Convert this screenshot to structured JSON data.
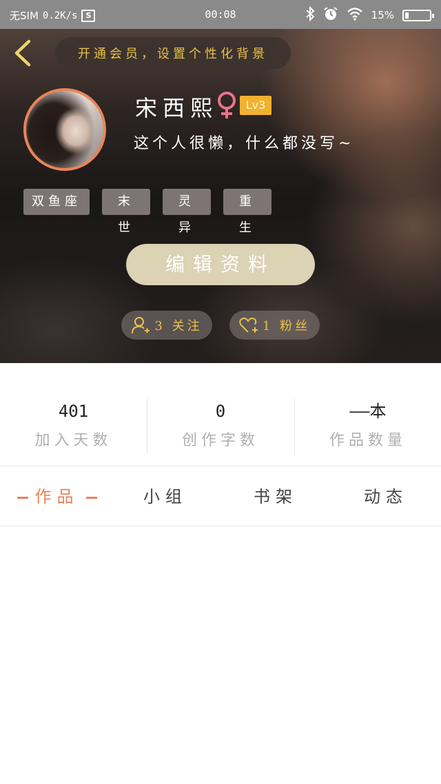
{
  "status_bar": {
    "sim": "无SIM",
    "speed": "0.2K/s",
    "screenshot_label": "S",
    "time": "00:08",
    "battery_text": "15%",
    "battery_level": 0.15
  },
  "header": {
    "vip_banner": "开通会员，设置个性化背景"
  },
  "profile": {
    "username": "宋西熙",
    "gender_icon": "female-icon",
    "level": "Lv3",
    "bio": "这个人很懒，什么都没写~",
    "tags": [
      "双鱼座",
      "末世",
      "灵异",
      "重生"
    ],
    "edit_button": "编辑资料",
    "following": "3 关注",
    "fans": "1 粉丝"
  },
  "stats": [
    {
      "value": "401",
      "label": "加入天数"
    },
    {
      "value": "0",
      "label": "创作字数"
    },
    {
      "value": "——本",
      "label": "作品数量"
    }
  ],
  "tabs": {
    "works": "作品",
    "groups": "小组",
    "shelf": "书架",
    "activity": "动态"
  },
  "colors": {
    "accent": "#e8845a",
    "gold": "#e8c24a",
    "level_badge": "#f1b22f",
    "gender": "#e8738a",
    "edit_button": "#dcd2b4"
  }
}
